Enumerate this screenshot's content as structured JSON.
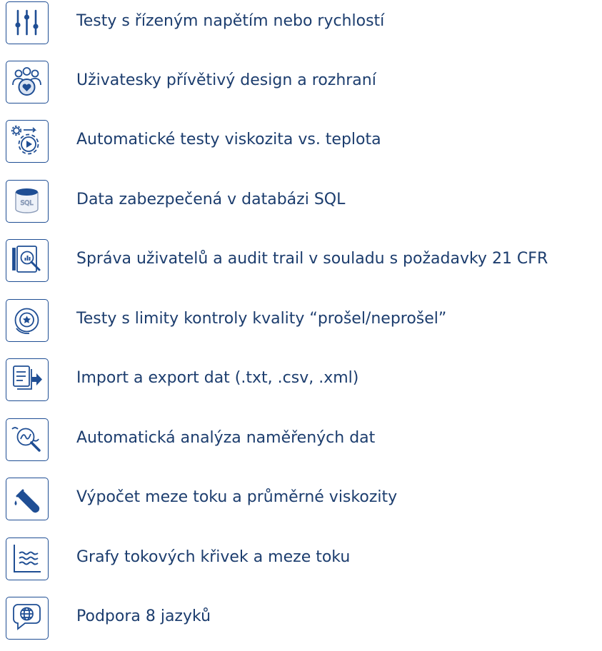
{
  "colors": {
    "icon_stroke": "#1f4e94",
    "icon_light": "#d9e3f2",
    "text": "#1c3d6e",
    "background": "#ffffff"
  },
  "features": [
    {
      "icon": "sliders-icon",
      "label": "Testy s řízeným napětím nebo rychlostí"
    },
    {
      "icon": "user-group-heart-icon",
      "label": "Uživatesky přívětivý design a rozhraní"
    },
    {
      "icon": "gear-play-icon",
      "label": "Automatické testy viskozita vs. teplota"
    },
    {
      "icon": "sql-database-icon",
      "label": "Data zabezpečená v databázi SQL"
    },
    {
      "icon": "audit-search-icon",
      "label": "Správa uživatelů a audit trail v souladu s požadavky 21 CFR"
    },
    {
      "icon": "quality-badge-icon",
      "label": "Testy s limity kontroly kvality “prošel/neprošel”"
    },
    {
      "icon": "import-export-icon",
      "label": "Import a export dat (.txt, .csv, .xml)"
    },
    {
      "icon": "data-analysis-icon",
      "label": "Automatická analýza naměřených dat"
    },
    {
      "icon": "pour-liquid-icon",
      "label": "Výpočet meze toku a průměrné viskozity"
    },
    {
      "icon": "flow-curve-chart-icon",
      "label": "Grafy tokových křivek a meze toku"
    },
    {
      "icon": "language-globe-icon",
      "label": "Podpora 8 jazyků"
    }
  ]
}
